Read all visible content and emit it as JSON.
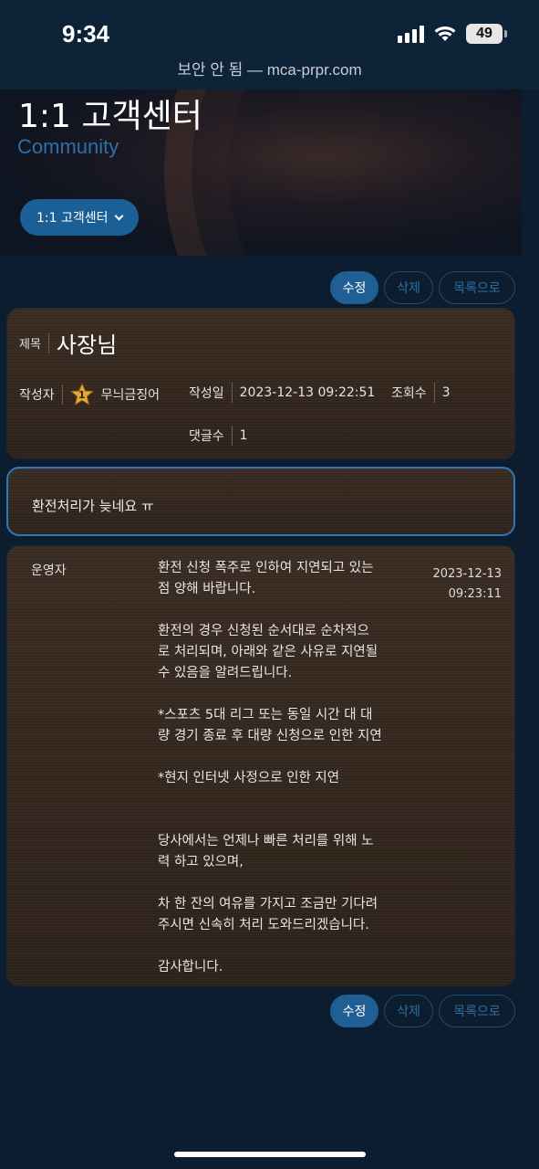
{
  "status_bar": {
    "time": "9:34",
    "battery": "49"
  },
  "browser": {
    "url_text": "보안 안 됨 — mca-prpr.com"
  },
  "hero": {
    "title": "1:1 고객센터",
    "subtitle": "Community",
    "dropdown_label": "1:1 고객센터"
  },
  "actions": {
    "edit": "수정",
    "delete": "삭제",
    "list": "목록으로"
  },
  "post": {
    "subject_label": "제목",
    "subject": "사장님",
    "author_label": "작성자",
    "author_level": "1",
    "author": "무늬금징어",
    "date_label": "작성일",
    "date": "2023-12-13 09:22:51",
    "views_label": "조회수",
    "views": "3",
    "comments_label": "댓글수",
    "comments": "1"
  },
  "question": {
    "text": "환전처리가 늦네요 ㅠ"
  },
  "answer": {
    "author": "운영자",
    "body": "환전 신청 폭주로 인하여 지연되고 있는\n점 양해 바랍니다.\n\n환전의 경우 신청된 순서대로 순차적으\n로 처리되며, 아래와 같은 사유로 지연될\n수 있음을 알려드립니다.\n\n*스포츠 5대 리그 또는 동일 시간 대 대\n량 경기 종료 후 대량 신청으로 인한 지연\n\n*현지 인터넷 사정으로 인한 지연\n\n\n당사에서는 언제나 빠른 처리를 위해 노\n력 하고 있으며,\n\n차 한 잔의 여유를 가지고 조금만 기다려\n주시면 신속히 처리 도와드리겠습니다.\n\n감사합니다.",
    "date": "2023-12-13",
    "time": "09:23:11"
  }
}
